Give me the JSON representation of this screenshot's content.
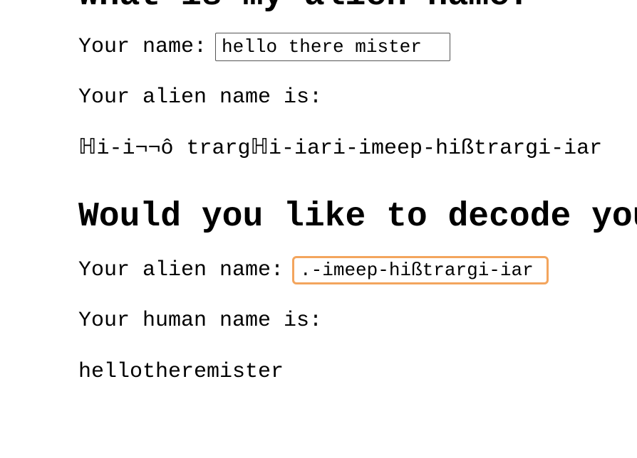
{
  "section1": {
    "heading": "What is my alien name?",
    "nameLabel": "Your name:",
    "nameValue": "hello there mister",
    "alienResultLabel": "Your alien name is:",
    "alienResult": "ℍi-i¬¬ô trargℍi-iari-imeep-hißtrargi-iar"
  },
  "section2": {
    "heading": "Would you like to decode your alien name?",
    "alienLabel": "Your alien name:",
    "alienValue": ".-imeep-hißtrargi-iar",
    "humanResultLabel": "Your human name is:",
    "humanResult": "hellotheremister"
  }
}
